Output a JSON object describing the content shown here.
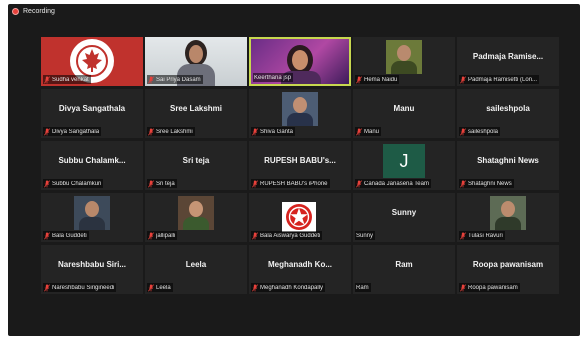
{
  "recording": {
    "label": "Recording"
  },
  "participants": [
    {
      "caption": "Sudha venkat",
      "name": "",
      "muted": true,
      "display": "video-logo"
    },
    {
      "caption": "Sai Priya Dasam",
      "name": "",
      "muted": true,
      "display": "video-person"
    },
    {
      "caption": "Keerthana jsp",
      "name": "",
      "muted": false,
      "display": "video-person",
      "active": true
    },
    {
      "caption": "Hema Naidu",
      "name": "",
      "muted": true,
      "display": "photo"
    },
    {
      "caption": "Padmaja Ramisetti (Lon...",
      "name": "Padmaja  Ramise...",
      "muted": true,
      "display": "name"
    },
    {
      "caption": "Divya Sangathala",
      "name": "Divya Sangathala",
      "muted": true,
      "display": "name"
    },
    {
      "caption": "Sree Lakshmi",
      "name": "Sree Lakshmi",
      "muted": true,
      "display": "name"
    },
    {
      "caption": "Shiva Ganta",
      "name": "",
      "muted": true,
      "display": "photo"
    },
    {
      "caption": "Manu",
      "name": "Manu",
      "muted": true,
      "display": "name"
    },
    {
      "caption": "saileshpola",
      "name": "saileshpola",
      "muted": true,
      "display": "name"
    },
    {
      "caption": "Subbu Chalamkuri",
      "name": "Subbu  Chalamk...",
      "muted": true,
      "display": "name"
    },
    {
      "caption": "Sri teja",
      "name": "Sri teja",
      "muted": true,
      "display": "name"
    },
    {
      "caption": "RUPESH BABU's iPhone",
      "name": "RUPESH BABU's...",
      "muted": true,
      "display": "name"
    },
    {
      "caption": "Canada Janasena Team",
      "name": "",
      "muted": true,
      "display": "initial",
      "initial": "J"
    },
    {
      "caption": "Shataghni News",
      "name": "Shataghni News",
      "muted": true,
      "display": "name"
    },
    {
      "caption": "Bala Guddeti",
      "name": "",
      "muted": true,
      "display": "photo"
    },
    {
      "caption": "jallipalli",
      "name": "",
      "muted": true,
      "display": "photo"
    },
    {
      "caption": "Bala Aiswarya Guddeti",
      "name": "",
      "muted": true,
      "display": "logo-star"
    },
    {
      "caption": "Sunny",
      "name": "Sunny",
      "muted": false,
      "display": "name"
    },
    {
      "caption": "Tulasi Ravuri",
      "name": "",
      "muted": true,
      "display": "photo"
    },
    {
      "caption": "Nareshbabu Sirigineedi",
      "name": "Nareshbabu  Siri...",
      "muted": true,
      "display": "name"
    },
    {
      "caption": "Leela",
      "name": "Leela",
      "muted": true,
      "display": "name"
    },
    {
      "caption": "Meghanadh Kondapally",
      "name": "Meghanadh  Ko...",
      "muted": true,
      "display": "name"
    },
    {
      "caption": "Ram",
      "name": "Ram",
      "muted": false,
      "display": "name"
    },
    {
      "caption": "Roopa pawanisam",
      "name": "Roopa pawanisam",
      "muted": true,
      "display": "name"
    }
  ],
  "colors": {
    "window": "#1a1a1a",
    "tile": "#242424",
    "active_border": "#c7d84f",
    "muted_icon": "#e8413b",
    "initial_bg": "#1e5b46"
  }
}
